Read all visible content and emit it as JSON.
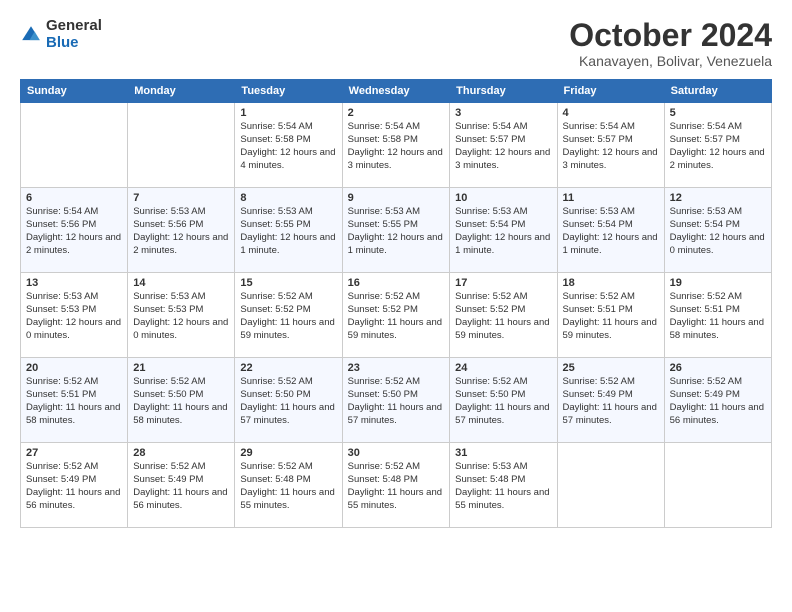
{
  "logo": {
    "general": "General",
    "blue": "Blue"
  },
  "title": "October 2024",
  "location": "Kanavayen, Bolivar, Venezuela",
  "days_of_week": [
    "Sunday",
    "Monday",
    "Tuesday",
    "Wednesday",
    "Thursday",
    "Friday",
    "Saturday"
  ],
  "weeks": [
    [
      {
        "day": "",
        "info": ""
      },
      {
        "day": "",
        "info": ""
      },
      {
        "day": "1",
        "info": "Sunrise: 5:54 AM\nSunset: 5:58 PM\nDaylight: 12 hours\nand 4 minutes."
      },
      {
        "day": "2",
        "info": "Sunrise: 5:54 AM\nSunset: 5:58 PM\nDaylight: 12 hours\nand 3 minutes."
      },
      {
        "day": "3",
        "info": "Sunrise: 5:54 AM\nSunset: 5:57 PM\nDaylight: 12 hours\nand 3 minutes."
      },
      {
        "day": "4",
        "info": "Sunrise: 5:54 AM\nSunset: 5:57 PM\nDaylight: 12 hours\nand 3 minutes."
      },
      {
        "day": "5",
        "info": "Sunrise: 5:54 AM\nSunset: 5:57 PM\nDaylight: 12 hours\nand 2 minutes."
      }
    ],
    [
      {
        "day": "6",
        "info": "Sunrise: 5:54 AM\nSunset: 5:56 PM\nDaylight: 12 hours\nand 2 minutes."
      },
      {
        "day": "7",
        "info": "Sunrise: 5:53 AM\nSunset: 5:56 PM\nDaylight: 12 hours\nand 2 minutes."
      },
      {
        "day": "8",
        "info": "Sunrise: 5:53 AM\nSunset: 5:55 PM\nDaylight: 12 hours\nand 1 minute."
      },
      {
        "day": "9",
        "info": "Sunrise: 5:53 AM\nSunset: 5:55 PM\nDaylight: 12 hours\nand 1 minute."
      },
      {
        "day": "10",
        "info": "Sunrise: 5:53 AM\nSunset: 5:54 PM\nDaylight: 12 hours\nand 1 minute."
      },
      {
        "day": "11",
        "info": "Sunrise: 5:53 AM\nSunset: 5:54 PM\nDaylight: 12 hours\nand 1 minute."
      },
      {
        "day": "12",
        "info": "Sunrise: 5:53 AM\nSunset: 5:54 PM\nDaylight: 12 hours\nand 0 minutes."
      }
    ],
    [
      {
        "day": "13",
        "info": "Sunrise: 5:53 AM\nSunset: 5:53 PM\nDaylight: 12 hours\nand 0 minutes."
      },
      {
        "day": "14",
        "info": "Sunrise: 5:53 AM\nSunset: 5:53 PM\nDaylight: 12 hours\nand 0 minutes."
      },
      {
        "day": "15",
        "info": "Sunrise: 5:52 AM\nSunset: 5:52 PM\nDaylight: 11 hours\nand 59 minutes."
      },
      {
        "day": "16",
        "info": "Sunrise: 5:52 AM\nSunset: 5:52 PM\nDaylight: 11 hours\nand 59 minutes."
      },
      {
        "day": "17",
        "info": "Sunrise: 5:52 AM\nSunset: 5:52 PM\nDaylight: 11 hours\nand 59 minutes."
      },
      {
        "day": "18",
        "info": "Sunrise: 5:52 AM\nSunset: 5:51 PM\nDaylight: 11 hours\nand 59 minutes."
      },
      {
        "day": "19",
        "info": "Sunrise: 5:52 AM\nSunset: 5:51 PM\nDaylight: 11 hours\nand 58 minutes."
      }
    ],
    [
      {
        "day": "20",
        "info": "Sunrise: 5:52 AM\nSunset: 5:51 PM\nDaylight: 11 hours\nand 58 minutes."
      },
      {
        "day": "21",
        "info": "Sunrise: 5:52 AM\nSunset: 5:50 PM\nDaylight: 11 hours\nand 58 minutes."
      },
      {
        "day": "22",
        "info": "Sunrise: 5:52 AM\nSunset: 5:50 PM\nDaylight: 11 hours\nand 57 minutes."
      },
      {
        "day": "23",
        "info": "Sunrise: 5:52 AM\nSunset: 5:50 PM\nDaylight: 11 hours\nand 57 minutes."
      },
      {
        "day": "24",
        "info": "Sunrise: 5:52 AM\nSunset: 5:50 PM\nDaylight: 11 hours\nand 57 minutes."
      },
      {
        "day": "25",
        "info": "Sunrise: 5:52 AM\nSunset: 5:49 PM\nDaylight: 11 hours\nand 57 minutes."
      },
      {
        "day": "26",
        "info": "Sunrise: 5:52 AM\nSunset: 5:49 PM\nDaylight: 11 hours\nand 56 minutes."
      }
    ],
    [
      {
        "day": "27",
        "info": "Sunrise: 5:52 AM\nSunset: 5:49 PM\nDaylight: 11 hours\nand 56 minutes."
      },
      {
        "day": "28",
        "info": "Sunrise: 5:52 AM\nSunset: 5:49 PM\nDaylight: 11 hours\nand 56 minutes."
      },
      {
        "day": "29",
        "info": "Sunrise: 5:52 AM\nSunset: 5:48 PM\nDaylight: 11 hours\nand 55 minutes."
      },
      {
        "day": "30",
        "info": "Sunrise: 5:52 AM\nSunset: 5:48 PM\nDaylight: 11 hours\nand 55 minutes."
      },
      {
        "day": "31",
        "info": "Sunrise: 5:53 AM\nSunset: 5:48 PM\nDaylight: 11 hours\nand 55 minutes."
      },
      {
        "day": "",
        "info": ""
      },
      {
        "day": "",
        "info": ""
      }
    ]
  ]
}
